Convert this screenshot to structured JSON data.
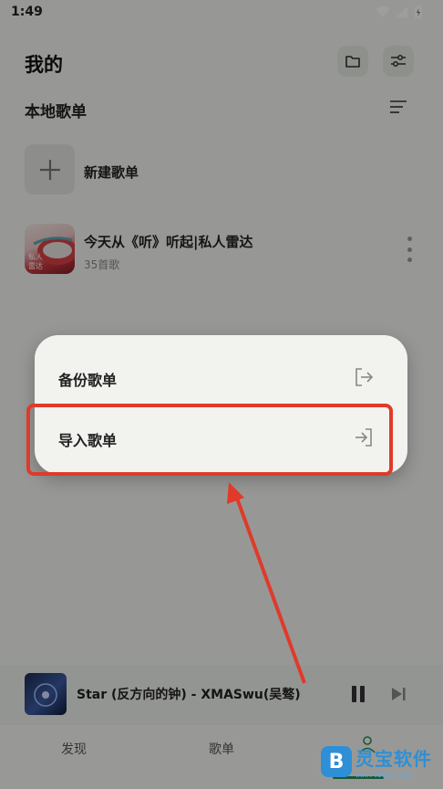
{
  "status_bar": {
    "time": "1:49"
  },
  "header": {
    "title": "我的",
    "folder_icon": "folder-icon",
    "settings_icon": "sliders-icon"
  },
  "local_playlists": {
    "section_title": "本地歌单",
    "sort_icon": "sort-list-icon",
    "new_playlist_label": "新建歌单",
    "playlists": [
      {
        "title": "今天从《听》听起|私人雷达",
        "count": "35首歌",
        "cover_text": "私人\n雷达"
      }
    ]
  },
  "menu": {
    "items": [
      {
        "label": "备份歌单",
        "icon": "export-icon"
      },
      {
        "label": "导入歌单",
        "icon": "import-icon"
      }
    ],
    "highlighted": "导入歌单"
  },
  "mini_player": {
    "title": "Star (反方向的钟) - XMASwu(吴骜)",
    "pause_icon": "pause-icon",
    "next_icon": "skip-next-icon"
  },
  "bottom_nav": {
    "items": [
      "发现",
      "歌单"
    ]
  },
  "watermark": {
    "name": "灵宝软件",
    "url": "www.lbwbw.com",
    "logo_letter": "B"
  },
  "colors": {
    "highlight": "#e03a2a",
    "overlay": "rgba(0,0,0,0.38)"
  }
}
